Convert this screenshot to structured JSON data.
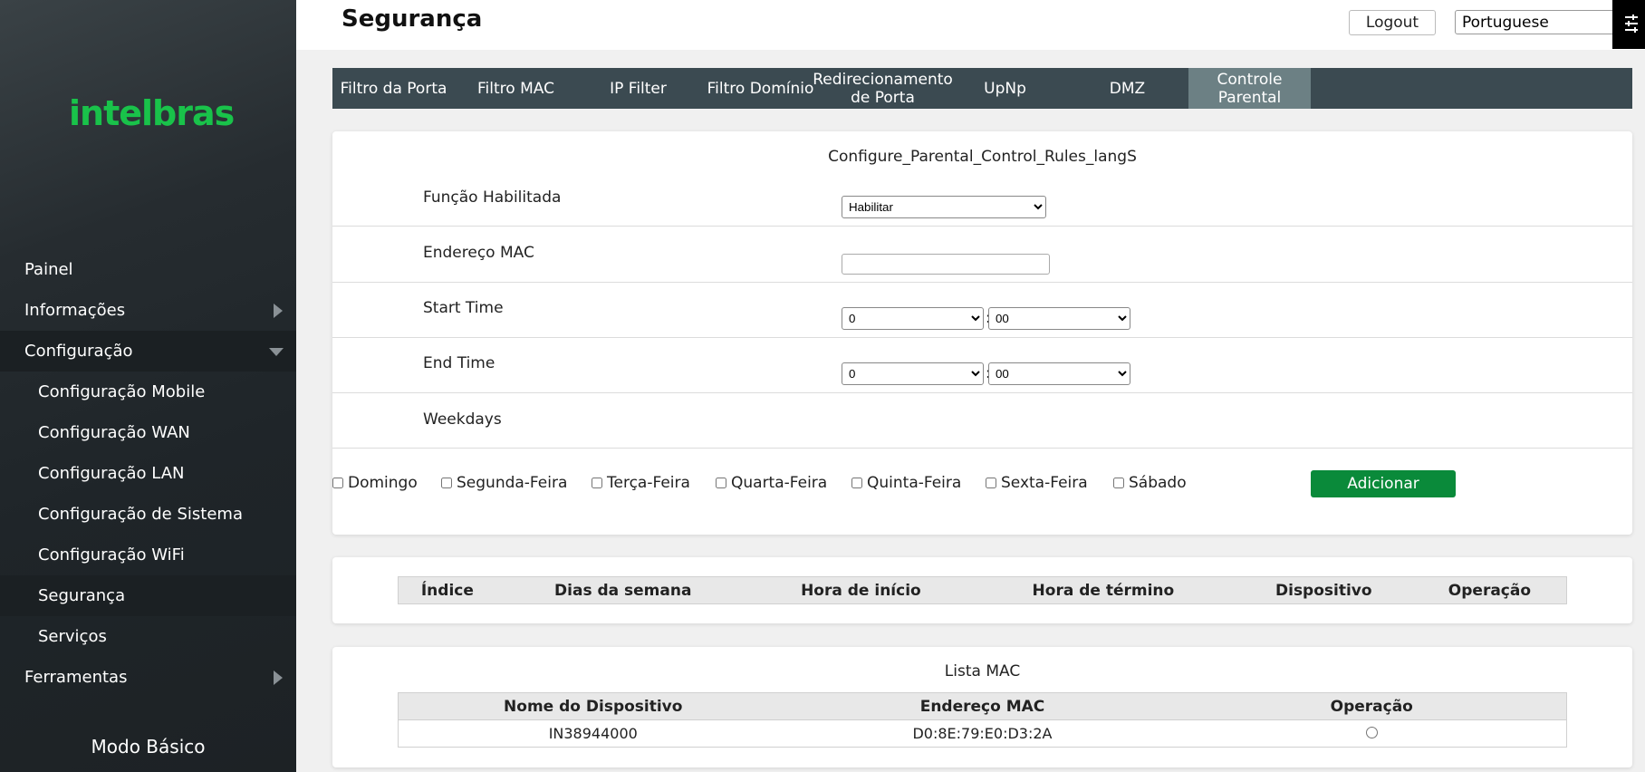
{
  "brand": {
    "logo_text": "intelbras",
    "logo_color": "#19c24a"
  },
  "sidebar": {
    "items": [
      {
        "label": "Painel",
        "level": 0,
        "arrow": "none"
      },
      {
        "label": "Informações",
        "level": 0,
        "arrow": "right"
      },
      {
        "label": "Configuração",
        "level": 0,
        "arrow": "down"
      },
      {
        "label": "Configuração Mobile",
        "level": 1
      },
      {
        "label": "Configuração WAN",
        "level": 1
      },
      {
        "label": "Configuração LAN",
        "level": 1
      },
      {
        "label": "Configuração de Sistema",
        "level": 1
      },
      {
        "label": "Configuração WiFi",
        "level": 1
      },
      {
        "label": "Segurança",
        "level": 1,
        "active": true
      },
      {
        "label": "Serviços",
        "level": 1
      },
      {
        "label": "Ferramentas",
        "level": 0,
        "arrow": "right"
      }
    ],
    "mode_label": "Modo Básico"
  },
  "header": {
    "title": "Segurança",
    "logout_label": "Logout",
    "language_selected": "Portuguese",
    "corner_icon": "settings-sliders-icon"
  },
  "tabs": [
    {
      "label": "Filtro da Porta"
    },
    {
      "label": "Filtro MAC"
    },
    {
      "label": "IP Filter"
    },
    {
      "label": "Filtro Domínio"
    },
    {
      "label": "Redirecionamento de Porta"
    },
    {
      "label": "UpNp"
    },
    {
      "label": "DMZ"
    },
    {
      "label": "Controle Parental",
      "active": true
    }
  ],
  "config": {
    "title": "Configure_Parental_Control_Rules_langS",
    "function_label": "Função Habilitada",
    "function_value": "Habilitar",
    "mac_label": "Endereço MAC",
    "mac_value": "",
    "start_label": "Start Time",
    "start_hour": "0",
    "start_min": "00",
    "end_label": "End Time",
    "end_hour": "0",
    "end_min": "00",
    "colon": ":",
    "weekdays_label": "Weekdays",
    "days": [
      "Domingo",
      "Segunda-Feira",
      "Terça-Feira",
      "Quarta-Feira",
      "Quinta-Feira",
      "Sexta-Feira",
      "Sábado"
    ],
    "add_label": "Adicionar",
    "add_color": "#0a8a3a"
  },
  "rules_table": {
    "headers": [
      "Índice",
      "Dias da semana",
      "Hora de início",
      "Hora de término",
      "Dispositivo",
      "Operação"
    ]
  },
  "mac_list": {
    "title": "Lista MAC",
    "headers": [
      "Nome do Dispositivo",
      "Endereço MAC",
      "Operação"
    ],
    "rows": [
      {
        "name": "IN38944000",
        "mac": "D0:8E:79:E0:D3:2A"
      }
    ]
  }
}
